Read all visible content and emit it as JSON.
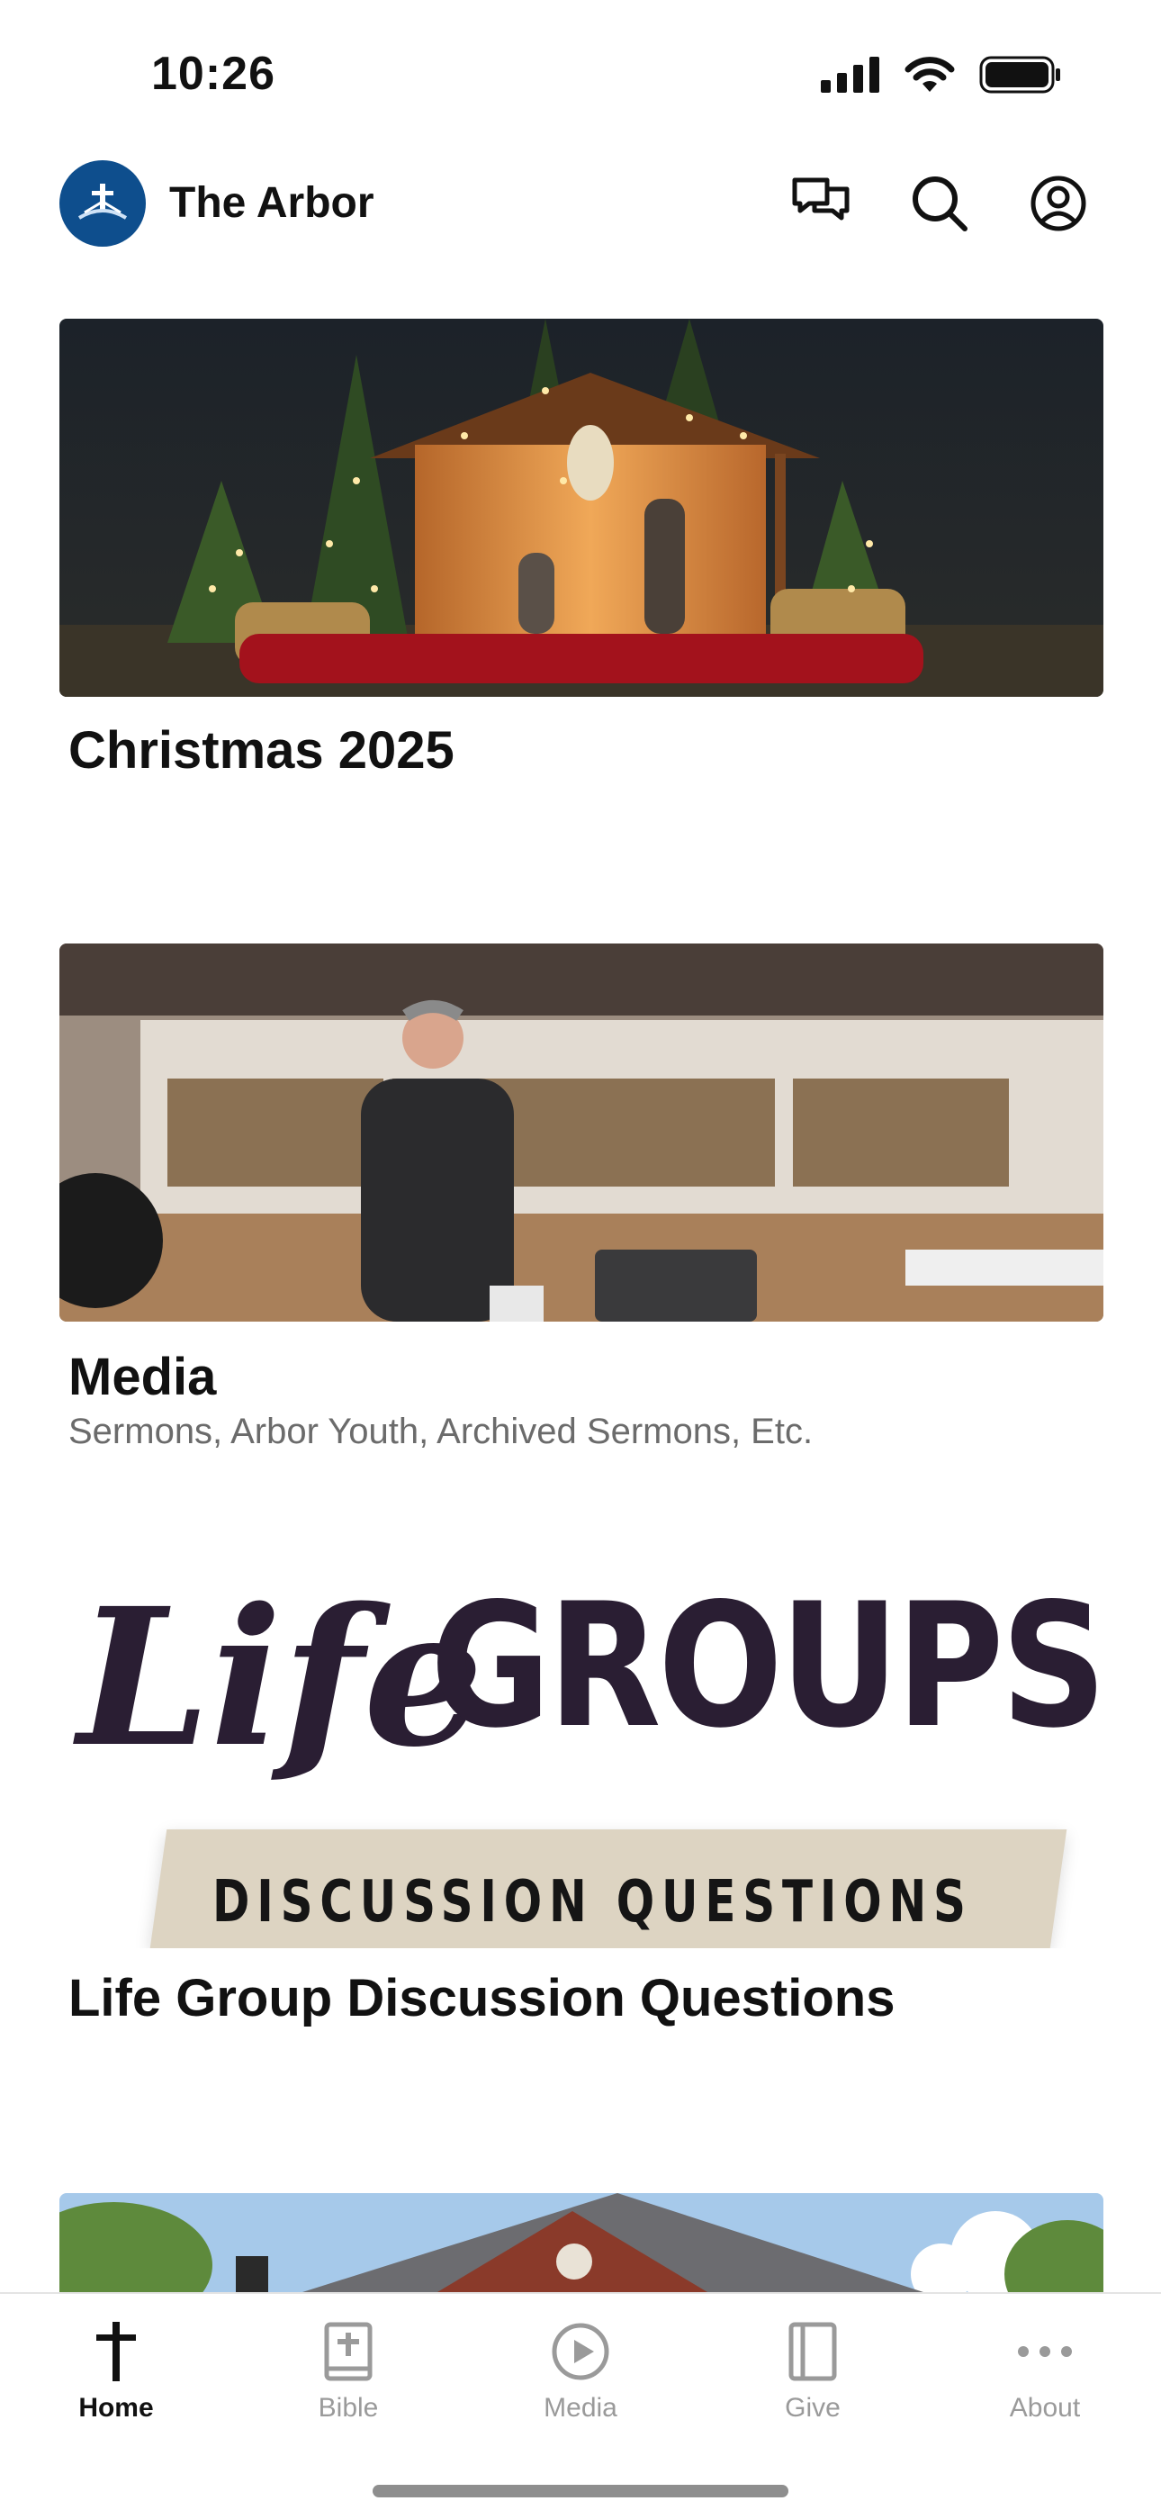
{
  "status": {
    "time": "10:26",
    "icons": [
      "signal-icon",
      "wifi-icon",
      "battery-icon"
    ]
  },
  "header": {
    "title": "The Arbor",
    "logo_icon": "cross-logo-icon",
    "actions": [
      "messages-icon",
      "search-icon",
      "profile-icon"
    ]
  },
  "cards": [
    {
      "title": "Christmas 2025",
      "subtitle": ""
    },
    {
      "title": "Media",
      "subtitle": "Sermons, Arbor Youth, Archived Sermons, Etc."
    },
    {
      "title": "Life Group Discussion Questions",
      "subtitle": "",
      "image_text": {
        "script": "Life",
        "block": "GROUPS",
        "banner": "DISCUSSION QUESTIONS"
      }
    },
    {
      "title": "",
      "subtitle": ""
    }
  ],
  "tabs": [
    {
      "label": "Home",
      "icon": "cross-icon",
      "active": true
    },
    {
      "label": "Bible",
      "icon": "bible-icon",
      "active": false
    },
    {
      "label": "Media",
      "icon": "play-icon",
      "active": false
    },
    {
      "label": "Give",
      "icon": "give-icon",
      "active": false
    },
    {
      "label": "About",
      "icon": "more-icon",
      "active": false
    }
  ],
  "colors": {
    "brand": "#0e4e8d",
    "lifegroups_text": "#2a1e33",
    "inactive_tab": "#9a9a9a"
  }
}
